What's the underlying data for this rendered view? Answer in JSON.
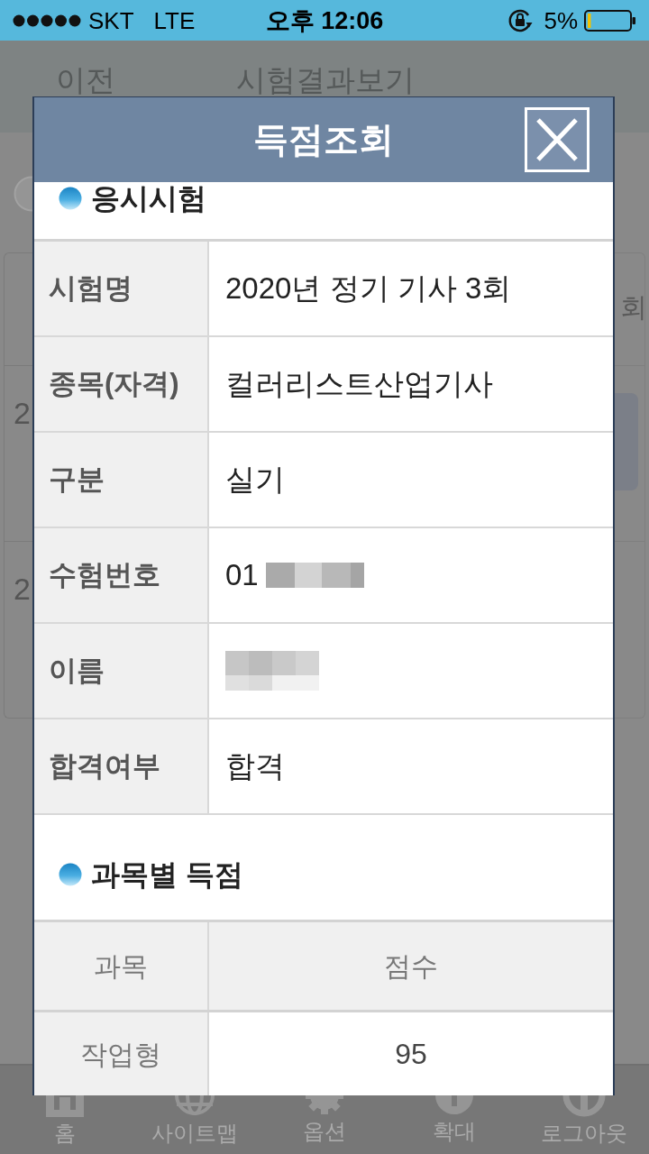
{
  "status_bar": {
    "carrier": "SKT",
    "network": "LTE",
    "time": "오후 12:06",
    "battery": "5%"
  },
  "page": {
    "back": "이전",
    "title": "시험결과보기",
    "left_edge": [
      "2",
      "2"
    ],
    "right_edge": "회"
  },
  "dialog": {
    "title": "득점조회",
    "sections": [
      {
        "kind": "fields",
        "title": "응시시험",
        "rows": [
          {
            "label": "시험명",
            "value": "2020년 정기 기사 3회",
            "redacted": false
          },
          {
            "label": "종목(자격)",
            "value": "컬러리스트산업기사",
            "redacted": false
          },
          {
            "label": "구분",
            "value": "실기",
            "redacted": false
          },
          {
            "label": "수험번호",
            "value": "01",
            "redacted": true
          },
          {
            "label": "이름",
            "redacted": true
          },
          {
            "label": "합격여부",
            "value": "합격",
            "redacted": false
          }
        ]
      },
      {
        "kind": "table",
        "title": "과목별 득점",
        "columns": [
          "과목",
          "점수"
        ],
        "rows": [
          [
            "작업형",
            "95"
          ]
        ]
      }
    ]
  },
  "tab_bar": [
    {
      "kind": "home",
      "label": "홈"
    },
    {
      "kind": "sitemap",
      "label": "사이트맵"
    },
    {
      "kind": "options",
      "label": "옵션"
    },
    {
      "kind": "zoom",
      "label": "확대"
    },
    {
      "kind": "logout",
      "label": "로그아웃"
    }
  ]
}
